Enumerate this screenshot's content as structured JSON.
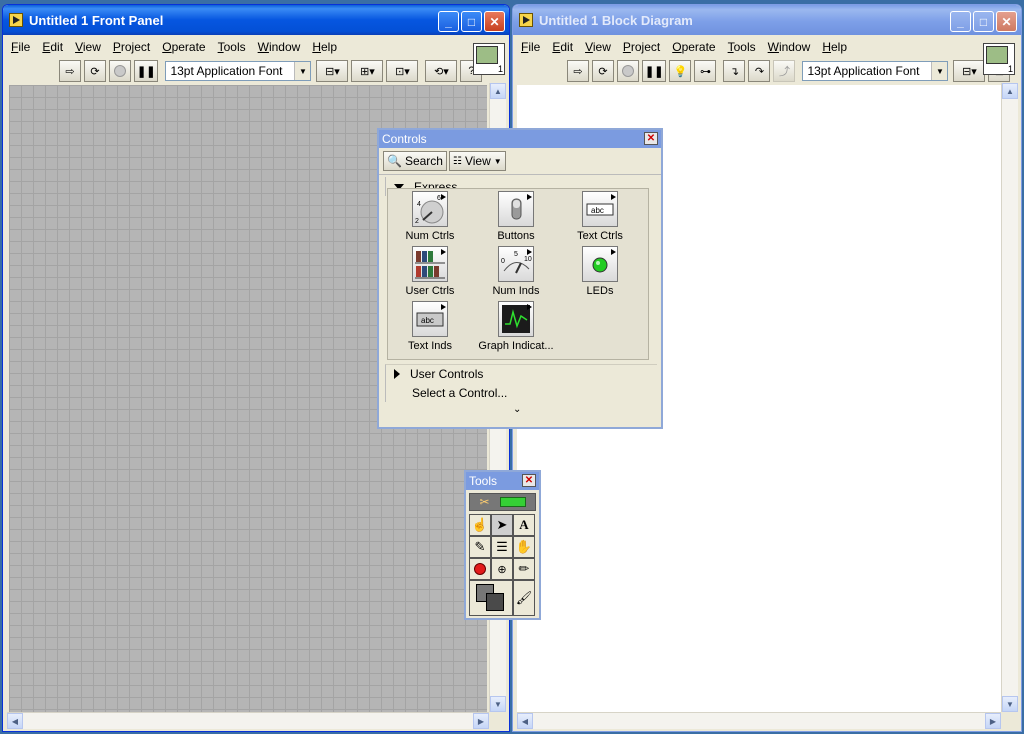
{
  "front_panel": {
    "title": "Untitled 1 Front Panel",
    "menu": [
      "File",
      "Edit",
      "View",
      "Project",
      "Operate",
      "Tools",
      "Window",
      "Help"
    ],
    "font": "13pt Application Font",
    "help_glyph": "?",
    "vi_icon_number": "1"
  },
  "block_diagram": {
    "title": "Untitled 1 Block Diagram",
    "menu": [
      "File",
      "Edit",
      "View",
      "Project",
      "Operate",
      "Tools",
      "Window",
      "Help"
    ],
    "font": "13pt Application Font"
  },
  "controls_palette": {
    "title": "Controls",
    "search_label": "Search",
    "view_label": "View",
    "express_label": "Express",
    "items": [
      "Num Ctrls",
      "Buttons",
      "Text Ctrls",
      "User Ctrls",
      "Num Inds",
      "LEDs",
      "Text Inds",
      "Graph Indicat..."
    ],
    "user_controls_label": "User Controls",
    "select_label": "Select a Control...",
    "icon_texts": {
      "abc1": "abc",
      "abc2": "abc",
      "scale_0": "0",
      "scale_5": "5",
      "scale_10": "10",
      "knob_4": "4",
      "knob_6": "6",
      "knob_2": "2"
    }
  },
  "tools_palette": {
    "title": "Tools"
  },
  "colors": {
    "accent": "#0a5fd8",
    "grid": "#b5b5b5",
    "led_on": "#22cc22"
  }
}
